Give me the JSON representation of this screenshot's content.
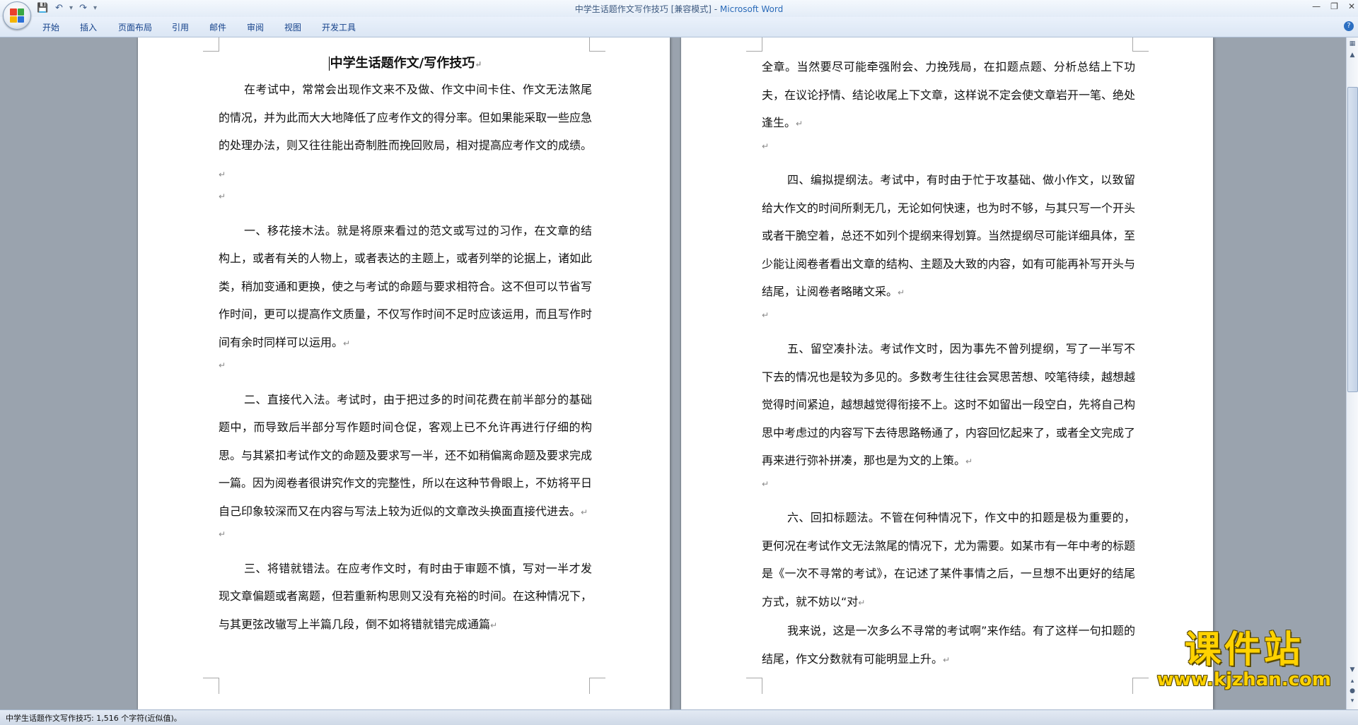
{
  "window": {
    "title_doc": "中学生话题作文写作技巧 [兼容模式] - ",
    "title_app": "Microsoft Word"
  },
  "ribbon": {
    "tabs": [
      "开始",
      "插入",
      "页面布局",
      "引用",
      "邮件",
      "审阅",
      "视图",
      "开发工具"
    ]
  },
  "document": {
    "page1": {
      "title": "中学生话题作文/写作技巧",
      "paragraphs": [
        "在考试中，常常会出现作文来不及做、作文中间卡住、作文无法煞尾的情况，并为此而大大地降低了应考作文的得分率。但如果能采取一些应急的处理办法，则又往往能出奇制胜而挽回败局，相对提高应考作文的成绩。",
        "",
        "一、移花接木法。就是将原来看过的范文或写过的习作，在文章的结构上，或者有关的人物上，或者表达的主题上，或者列举的论据上，诸如此类，稍加变通和更换，使之与考试的命题与要求相符合。这不但可以节省写作时间，更可以提高作文质量，不仅写作时间不足时应该运用，而且写作时间有余时同样可以运用。",
        "",
        "二、直接代入法。考试时，由于把过多的时间花费在前半部分的基础题中，而导致后半部分写作题时间仓促，客观上已不允许再进行仔细的构思。与其紧扣考试作文的命题及要求写一半，还不如稍偏离命题及要求完成一篇。因为阅卷者很讲究作文的完整性，所以在这种节骨眼上，不妨将平日自己印象较深而又在内容与写法上较为近似的文章改头换面直接代进去。",
        "",
        "三、将错就错法。在应考作文时，有时由于审题不慎，写对一半才发现文章偏题或者离题，但若重新构思则又没有充裕的时间。在这种情况下，与其更弦改辙写上半篇几段，倒不如将错就错完成通篇"
      ]
    },
    "page2": {
      "paragraphs": [
        "全章。当然要尽可能牵强附会、力挽残局，在扣题点题、分析总结上下功夫，在议论抒情、结论收尾上下文章，这样说不定会使文章岩开一笔、绝处逢生。",
        "",
        "四、编拟提纲法。考试中，有时由于忙于攻基础、做小作文，以致留给大作文的时间所剩无几，无论如何快速，也为时不够，与其只写一个开头或者干脆空着，总还不如列个提纲来得划算。当然提纲尽可能详细具体，至少能让阅卷者看出文章的结构、主题及大致的内容，如有可能再补写开头与结尾，让阅卷者略睹文采。",
        "",
        "五、留空凑扑法。考试作文时，因为事先不曾列提纲，写了一半写不下去的情况也是较为多见的。多数考生往往会冥思苦想、咬笔待续，越想越觉得时间紧迫，越想越觉得衔接不上。这时不如留出一段空白，先将自己构思中考虑过的内容写下去待思路畅通了，内容回忆起来了，或者全文完成了再来进行弥补拼凑，那也是为文的上策。",
        "",
        "六、回扣标题法。不管在何种情况下，作文中的扣题是极为重要的，更何况在考试作文无法煞尾的情况下，尤为需要。如某市有一年中考的标题是《一次不寻常的考试》，在记述了某件事情之后，一旦想不出更好的结尾方式，就不妨以“对",
        "我来说，这是一次多么不寻常的考试啊”来作结。有了这样一句扣题的结尾，作文分数就有可能明显上升。"
      ]
    }
  },
  "paragraph_mark": "↵",
  "statusbar": {
    "text": "中学生话题作文写作技巧: 1,516 个字符(近似值)。"
  },
  "watermark": {
    "title": "课件站",
    "url": "www.kjzhan.com"
  },
  "colors": {
    "office_logo": [
      "#e8412c",
      "#3aa743",
      "#f4b400",
      "#2b6fd6"
    ]
  }
}
